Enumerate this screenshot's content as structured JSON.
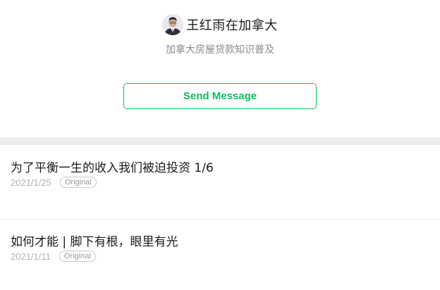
{
  "account": {
    "name": "王红雨在加拿大",
    "description": "加拿大房屋贷款知识普及"
  },
  "actions": {
    "send_message_label": "Send Message"
  },
  "articles": [
    {
      "title": "为了平衡一生的收入我们被迫投资 1/6",
      "date": "2021/1/25",
      "tag": "Original"
    },
    {
      "title": "如何才能 | 脚下有根，眼里有光",
      "date": "2021/1/11",
      "tag": "Original"
    }
  ],
  "colors": {
    "accent": "#07c160",
    "divider": "#ededed"
  },
  "icons": {
    "avatar": "profile-photo-avatar"
  }
}
